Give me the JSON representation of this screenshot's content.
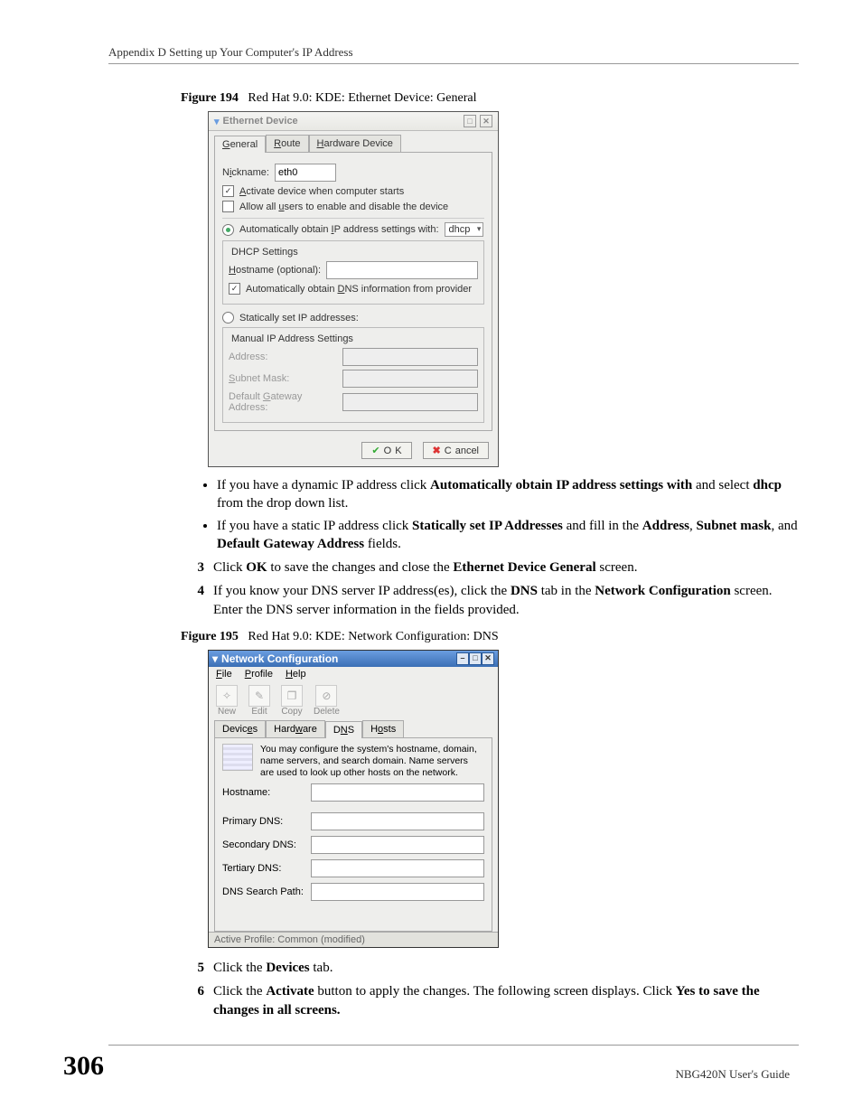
{
  "header": "Appendix D Setting up Your Computer's IP Address",
  "figure194": {
    "caption_num": "Figure 194",
    "caption_text": "Red Hat 9.0: KDE: Ethernet Device: General",
    "title": "Ethernet Device",
    "tabs": {
      "general": "General",
      "route": "Route",
      "hardware": "Hardware Device"
    },
    "nickname_label": "Nickname:",
    "nickname_value": "eth0",
    "activate_label": "Activate device when computer starts",
    "allowusers_label": "Allow all users to enable and disable the device",
    "auto_ip_label": "Automatically obtain IP address settings with:",
    "auto_ip_select": "dhcp",
    "dhcp_title": "DHCP Settings",
    "hostname_label": "Hostname (optional):",
    "auto_dns_label": "Automatically obtain DNS information from provider",
    "static_label": "Statically set IP addresses:",
    "manual_title": "Manual IP Address Settings",
    "address_label": "Address:",
    "subnet_label": "Subnet Mask:",
    "gateway_label": "Default Gateway Address:",
    "ok": "OK",
    "cancel": "Cancel"
  },
  "body1": {
    "li1a": "If you have a dynamic IP address click ",
    "li1b": "Automatically obtain IP address settings with",
    "li1c": " and select ",
    "li1d": "dhcp",
    "li1e": " from the drop down list.",
    "li2a": "If you have a static IP address click ",
    "li2b": "Statically set IP Addresses",
    "li2c": " and fill in the ",
    "li2d": "Address",
    "li2e": ", ",
    "li2f": "Subnet mask",
    "li2g": ", and ",
    "li2h": "Default Gateway Address",
    "li2i": " fields.",
    "s3n": "3",
    "s3a": "Click ",
    "s3b": "OK",
    "s3c": " to save the changes and close the ",
    "s3d": "Ethernet Device General",
    "s3e": " screen.",
    "s4n": "4",
    "s4a": "If you know your DNS server IP address(es), click the ",
    "s4b": "DNS",
    "s4c": " tab in the ",
    "s4d": "Network Configuration",
    "s4e": " screen. Enter the DNS server information in the fields provided."
  },
  "figure195": {
    "caption_num": "Figure 195",
    "caption_text": "Red Hat 9.0: KDE: Network Configuration: DNS",
    "title": "Network Configuration",
    "menus": {
      "file": "File",
      "profile": "Profile",
      "help": "Help"
    },
    "toolbar": {
      "new": "New",
      "edit": "Edit",
      "copy": "Copy",
      "delete": "Delete"
    },
    "tabs": {
      "devices": "Devices",
      "hardware": "Hardware",
      "dns": "DNS",
      "hosts": "Hosts"
    },
    "info": "You may configure the system's hostname, domain, name servers, and search domain. Name servers are used to look up other hosts on the network.",
    "hostname_label": "Hostname:",
    "primary_label": "Primary DNS:",
    "secondary_label": "Secondary DNS:",
    "tertiary_label": "Tertiary DNS:",
    "search_label": "DNS Search Path:",
    "status": "Active Profile: Common (modified)"
  },
  "body2": {
    "s5n": "5",
    "s5a": "Click the ",
    "s5b": "Devices",
    "s5c": " tab.",
    "s6n": "6",
    "s6a": "Click the ",
    "s6b": "Activate",
    "s6c": " button to apply the changes. The following screen displays. Click ",
    "s6d": "Yes to save the changes in all screens."
  },
  "footer": {
    "page": "306",
    "guide": "NBG420N User's Guide"
  }
}
